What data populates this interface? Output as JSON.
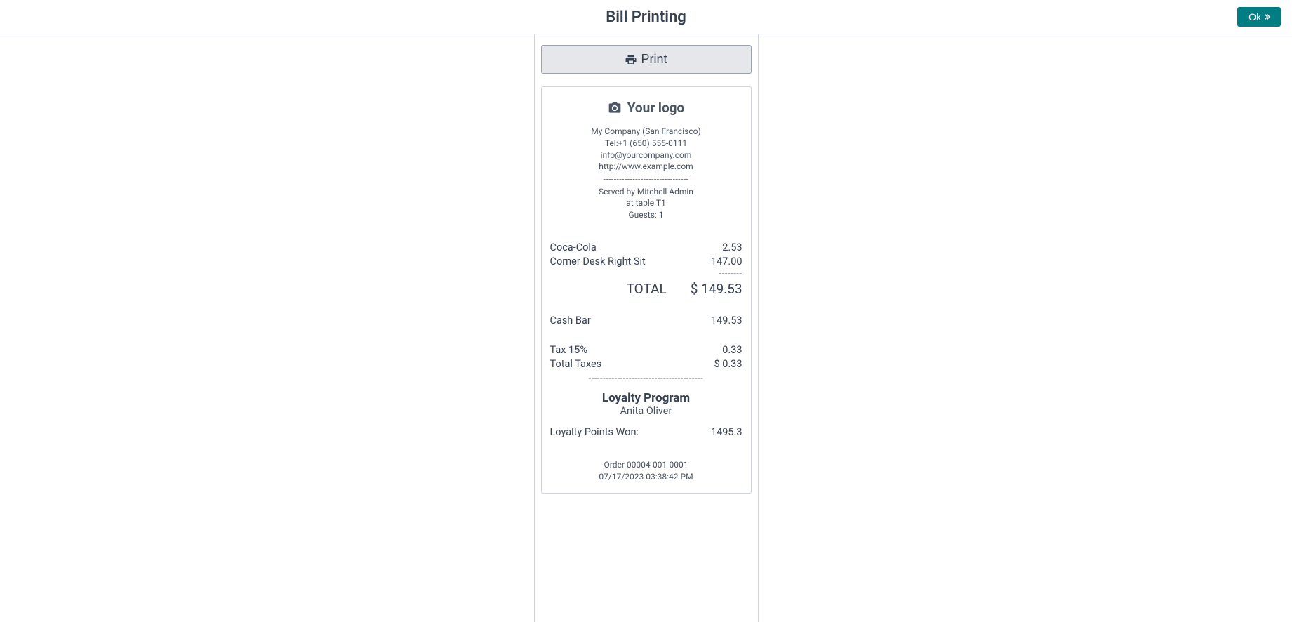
{
  "header": {
    "title": "Bill Printing",
    "ok_label": "Ok"
  },
  "print_button_label": "Print",
  "receipt": {
    "logo_text": "Your logo",
    "company": {
      "name": "My Company (San Francisco)",
      "tel": "Tel:+1 (650) 555-0111",
      "email": "info@yourcompany.com",
      "website": "http://www.example.com"
    },
    "served": {
      "by": "Served by Mitchell Admin",
      "table": "at table T1",
      "guests": "Guests: 1"
    },
    "items": [
      {
        "name": "Coca-Cola",
        "price": "2.53"
      },
      {
        "name": "Corner Desk Right Sit",
        "price": "147.00"
      }
    ],
    "total": {
      "label": "TOTAL",
      "amount": "$ 149.53"
    },
    "payment": {
      "method": "Cash Bar",
      "amount": "149.53"
    },
    "tax": {
      "label": "Tax 15%",
      "amount": "0.33",
      "total_label": "Total Taxes",
      "total_amount": "$ 0.33"
    },
    "loyalty": {
      "title": "Loyalty Program",
      "customer": "Anita Oliver",
      "points_label": "Loyalty Points Won:",
      "points_value": "1495.3"
    },
    "footer": {
      "order": "Order 00004-001-0001",
      "datetime": "07/17/2023 03:38:42 PM"
    }
  }
}
